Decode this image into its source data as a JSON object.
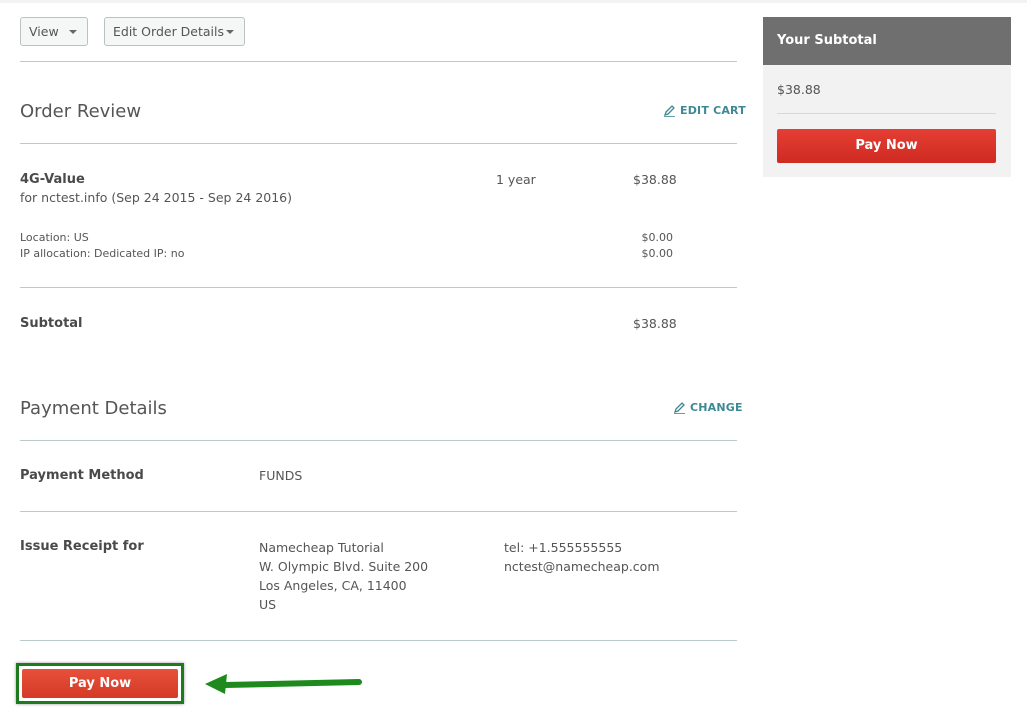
{
  "toolbar": {
    "view_label": "View",
    "edit_label": "Edit Order Details"
  },
  "order_review": {
    "title": "Order Review",
    "edit_cart": "EDIT CART",
    "item": {
      "name": "4G-Value",
      "description": "for nctest.info (Sep 24 2015 - Sep 24 2016)",
      "period": "1 year",
      "price": "$38.88",
      "options": [
        {
          "label": "Location: US",
          "price": "$0.00"
        },
        {
          "label": "IP allocation: Dedicated IP: no",
          "price": "$0.00"
        }
      ]
    },
    "subtotal_label": "Subtotal",
    "subtotal_value": "$38.88"
  },
  "payment": {
    "title": "Payment Details",
    "change": "CHANGE",
    "method_label": "Payment Method",
    "method_value": "FUNDS",
    "receipt_label": "Issue Receipt for",
    "address": [
      "Namecheap Tutorial",
      "W. Olympic Blvd. Suite 200",
      "Los Angeles, CA,  11400",
      "US"
    ],
    "contact": [
      "tel: +1.555555555",
      "nctest@namecheap.com"
    ]
  },
  "sidebar": {
    "title": "Your Subtotal",
    "amount": "$38.88",
    "pay_label": "Pay Now"
  },
  "bottom": {
    "pay_label": "Pay Now"
  },
  "colors": {
    "pay_button": "#d9342a",
    "accent_link": "#3e8a94",
    "highlight_border": "#1e7a1e",
    "panel_header": "#6f6f6f"
  }
}
